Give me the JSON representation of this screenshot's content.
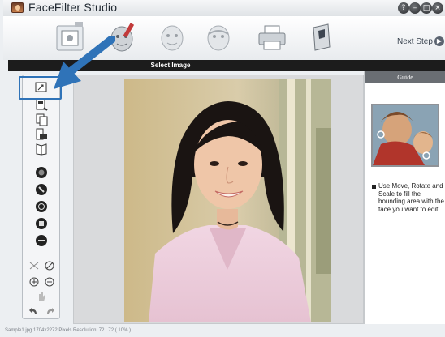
{
  "app": {
    "title": "FaceFilter Studio",
    "window_buttons": [
      "?",
      "–",
      "□",
      "×"
    ]
  },
  "toolbar": {
    "tools": [
      "open-image-tool",
      "face-paint-tool",
      "face-filter-tool",
      "face-mask-tool",
      "print-tool",
      "save-tool"
    ],
    "next_step_label": "Next Step"
  },
  "section": {
    "title": "Select Image"
  },
  "side_tools": [
    "open-file-icon",
    "scan-icon",
    "copy-icon",
    "paste-icon",
    "book-icon",
    "effect-1-icon",
    "effect-2-icon",
    "effect-3-icon",
    "effect-4-icon",
    "effect-5-icon",
    "fit-icon",
    "cancel-icon",
    "zoom-in-icon",
    "zoom-out-icon",
    "hand-icon",
    "undo-icon",
    "redo-icon"
  ],
  "guide": {
    "title": "Guide",
    "text": "Use Move, Rotate and Scale to fill the bounding area with the face you want to edit."
  },
  "status": {
    "text": "Sample1.jpg   1704x2272 Pixels   Resolution: 72 . 72 ( 10% )"
  },
  "colors": {
    "accent": "#2f73b8",
    "header": "#1c1c1c",
    "guide_header": "#6a6e73"
  }
}
